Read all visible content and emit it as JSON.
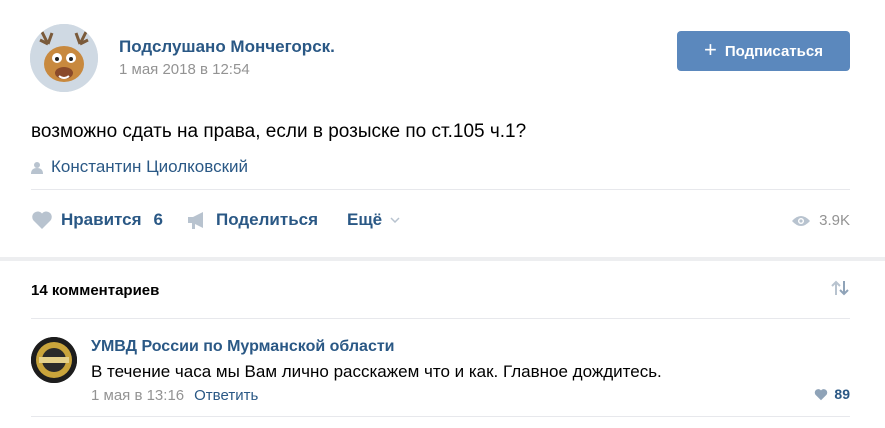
{
  "post": {
    "group_name": "Подслушано Мончегорск.",
    "date": "1 мая 2018 в 12:54",
    "subscribe_label": "Подписаться",
    "text": "возможно сдать на права, если в розыске по ст.105 ч.1?",
    "signer": "Константин Циолковский",
    "actions": {
      "like_label": "Нравится",
      "like_count": "6",
      "share_label": "Поделиться",
      "more_label": "Ещё"
    },
    "views": "3.9K"
  },
  "comments": {
    "count_label": "14 комментариев",
    "items": [
      {
        "author": "УМВД России по Мурманской области",
        "text": "В течение часа мы Вам лично расскажем что и как. Главное дождитесь.",
        "date": "1 мая в 13:16",
        "reply_label": "Ответить",
        "likes": "89"
      }
    ]
  },
  "colors": {
    "link": "#2a5885",
    "muted": "#939393",
    "button": "#5b88bd",
    "icon_grey": "#b8c3cf"
  },
  "icons": [
    "avatar-deer",
    "plus-icon",
    "user-icon",
    "heart-icon",
    "megaphone-icon",
    "chevron-down-icon",
    "eye-icon",
    "sort-arrows-icon",
    "avatar-police",
    "heart-small-icon"
  ]
}
